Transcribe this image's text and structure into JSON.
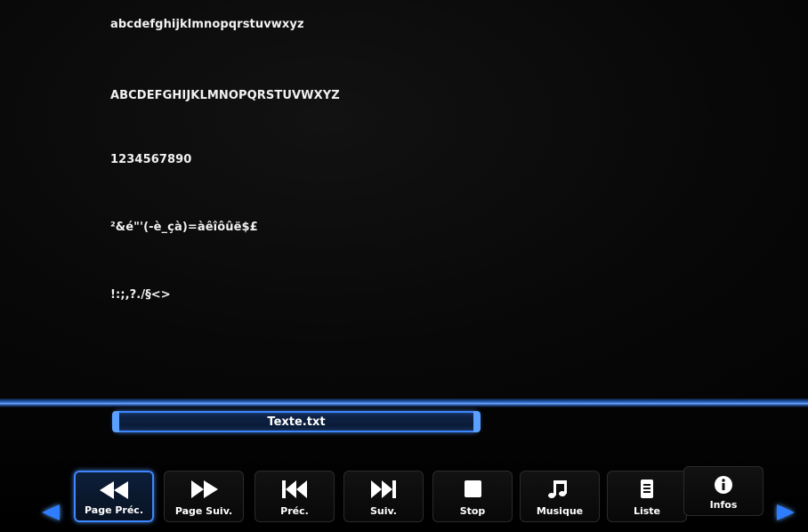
{
  "viewer": {
    "lines": [
      "abcdefghijklmnopqrstuvwxyz",
      "ABCDEFGHIJKLMNOPQRSTUVWXYZ",
      "1234567890",
      "²&é\"'(-è_çà)=àêîôûë$£",
      "!:;,?./§<>"
    ]
  },
  "file": {
    "name": "Texte.txt"
  },
  "toolbar": {
    "buttons": [
      {
        "label": "Page Préc.",
        "icon": "rewind-icon"
      },
      {
        "label": "Page Suiv.",
        "icon": "fast-forward-icon"
      },
      {
        "label": "Préc.",
        "icon": "skip-previous-icon"
      },
      {
        "label": "Suiv.",
        "icon": "skip-next-icon"
      },
      {
        "label": "Stop",
        "icon": "stop-icon"
      },
      {
        "label": "Musique",
        "icon": "music-note-icon"
      },
      {
        "label": "Liste",
        "icon": "list-document-icon"
      },
      {
        "label": "Infos",
        "icon": "info-icon"
      }
    ],
    "active_index": 0
  },
  "colors": {
    "accent": "#3d86ff",
    "text": "#ffffff",
    "background": "#060606"
  }
}
